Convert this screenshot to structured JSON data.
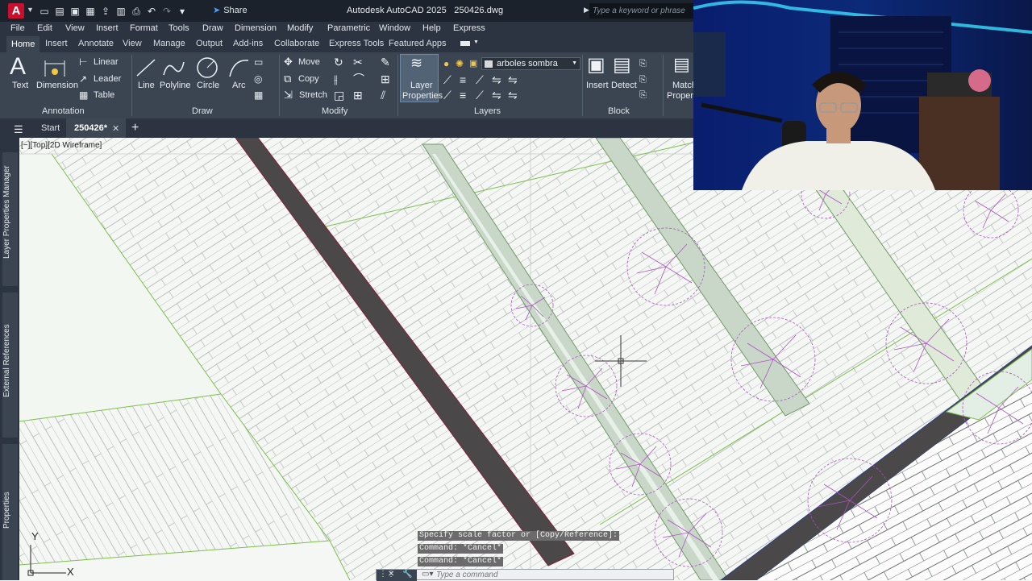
{
  "titlebar": {
    "app_letter": "A",
    "share": "Share",
    "app_name": "Autodesk AutoCAD 2025",
    "filename": "250426.dwg",
    "search_placeholder": "Type a keyword or phrase"
  },
  "menu": [
    "File",
    "Edit",
    "View",
    "Insert",
    "Format",
    "Tools",
    "Draw",
    "Dimension",
    "Modify",
    "Parametric",
    "Window",
    "Help",
    "Express"
  ],
  "ribbon_tabs": [
    "Home",
    "Insert",
    "Annotate",
    "View",
    "Manage",
    "Output",
    "Add-ins",
    "Collaborate",
    "Express Tools",
    "Featured Apps"
  ],
  "ribbon": {
    "annotation": {
      "title": "Annotation",
      "text": "Text",
      "dimension": "Dimension",
      "linear": "Linear",
      "leader": "Leader",
      "table": "Table"
    },
    "draw": {
      "title": "Draw",
      "line": "Line",
      "polyline": "Polyline",
      "circle": "Circle",
      "arc": "Arc"
    },
    "modify": {
      "title": "Modify",
      "move": "Move",
      "copy": "Copy",
      "stretch": "Stretch"
    },
    "layers": {
      "title": "Layers",
      "layer_properties_1": "Layer",
      "layer_properties_2": "Properties",
      "current_layer": "arboles sombra"
    },
    "block": {
      "title": "Block",
      "insert": "Insert",
      "detect": "Detect"
    },
    "properties": {
      "match_1": "Match",
      "match_2": "Propert"
    }
  },
  "doc_tabs": {
    "start": "Start",
    "current": "250426*"
  },
  "palettes": [
    "Layer Properties Manager",
    "External References",
    "Properties"
  ],
  "viewport_label": "[−][Top][2D Wireframe]",
  "ucs": {
    "x": "X",
    "y": "Y"
  },
  "command_history": [
    "Specify scale factor or [Copy/Reference]:",
    "Command: *Cancel*",
    "Command: *Cancel*"
  ],
  "command_placeholder": "Type a command",
  "colors": {
    "titlebar": "#1b222b",
    "ribbon": "#3b4552",
    "menubar": "#2b3440",
    "canvas": "#f3f6f3",
    "tree_magenta": "#b050c8",
    "green_lines": "#7cc04a",
    "dark_band": "#4a4848"
  }
}
